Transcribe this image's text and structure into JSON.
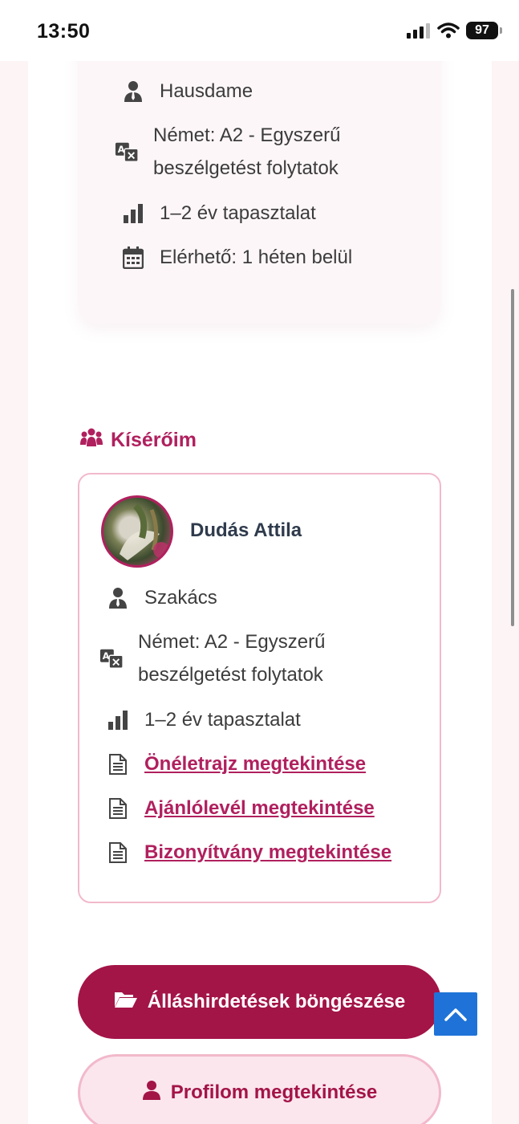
{
  "status_bar": {
    "time": "13:50",
    "battery": "97"
  },
  "top_card": {
    "items": [
      {
        "icon": "user-tie-icon",
        "text": "Hausdame"
      },
      {
        "icon": "language-icon",
        "line1": "Német: A2 - Egyszerű",
        "line2": "beszélgetést folytatok"
      },
      {
        "icon": "bar-chart-icon",
        "text": "1–2 év tapasztalat"
      },
      {
        "icon": "calendar-icon",
        "text": "Elérhető: 1 héten belül"
      }
    ]
  },
  "companions": {
    "title": "Kísérőim",
    "title_icon": "people-group-icon",
    "person": {
      "name": "Dudás Attila",
      "job": "Szakács",
      "language_line1": "Német: A2 - Egyszerű",
      "language_line2": "beszélgetést folytatok",
      "experience": "1–2 év tapasztalat",
      "links": [
        "Önéletrajz megtekintése",
        "Ajánlólevél megtekintése",
        "Bizonyítvány megtekintése"
      ]
    }
  },
  "buttons": {
    "browse_jobs": "Álláshirdetések böngészése",
    "view_profile": "Profilom megtekintése"
  },
  "colors": {
    "accent": "#b0205e",
    "primary_button": "#a31447",
    "secondary_button_bg": "#fbe6ee",
    "card_border": "#f2b9cb",
    "scroll_top_button": "#1f73d8"
  }
}
